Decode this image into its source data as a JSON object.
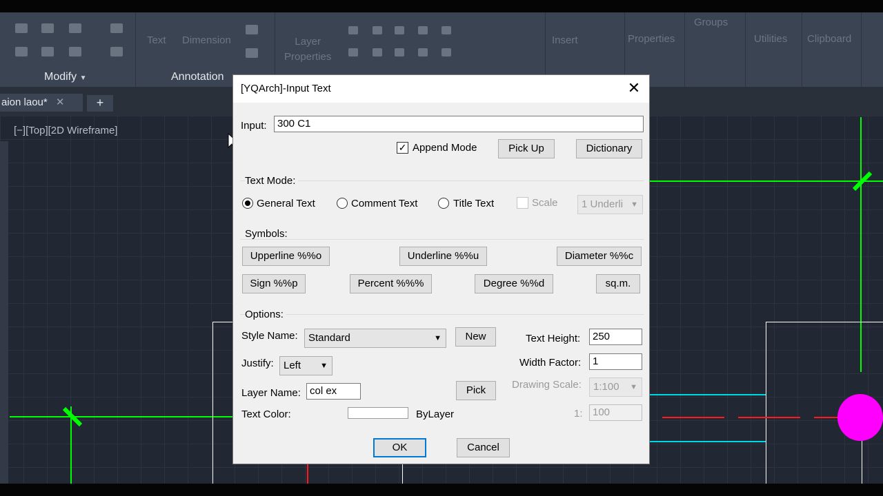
{
  "ribbon": {
    "text_label": "Text",
    "dimension_label": "Dimension",
    "layer_properties_label": "Layer\nProperties",
    "insert_label": "Insert",
    "properties_label": "Properties",
    "groups_label": "Groups",
    "utilities_label": "Utilities",
    "clipboard_label": "Clipboard",
    "modify_panel": "Modify",
    "annotation_panel": "Annotation"
  },
  "tabs": {
    "file_tab": "aion laou*",
    "close_glyph": "✕",
    "new_tab_glyph": "+"
  },
  "viewport": {
    "label": "[−][Top][2D Wireframe]"
  },
  "dialog": {
    "title": "[YQArch]-Input Text",
    "input_label": "Input:",
    "input_value": "300 C1",
    "append_mode_label": "Append Mode",
    "append_mode_checked": true,
    "pick_up_label": "Pick Up",
    "dictionary_label": "Dictionary",
    "text_mode_label": "Text Mode:",
    "mode_general": "General Text",
    "mode_comment": "Comment Text",
    "mode_title": "Title Text",
    "selected_mode": "General Text",
    "scale_label": "Scale",
    "underline_combo": "1 Underli",
    "symbols_label": "Symbols:",
    "sym_upperline": "Upperline %%o",
    "sym_underline": "Underline %%u",
    "sym_diameter": "Diameter %%c",
    "sym_sign": "Sign %%p",
    "sym_percent": "Percent %%%",
    "sym_degree": "Degree %%d",
    "sym_sqm": "sq.m.",
    "options_label": "Options:",
    "style_name_label": "Style Name:",
    "style_name_value": "Standard",
    "new_label": "New",
    "text_height_label": "Text Height:",
    "text_height_value": "250",
    "justify_label": "Justify:",
    "justify_value": "Left",
    "width_factor_label": "Width Factor:",
    "width_factor_value": "1",
    "drawing_scale_label": "Drawing Scale:",
    "drawing_scale_value": "1:100",
    "layer_name_label": "Layer Name:",
    "layer_name_value": "col ex",
    "pick_label": "Pick",
    "scale_prefix": "1:",
    "scale_value": "100",
    "text_color_label": "Text Color:",
    "text_color_value": "ByLayer",
    "ok_label": "OK",
    "cancel_label": "Cancel"
  },
  "colors": {
    "green": "#00ff00",
    "cyan": "#00d8e8",
    "red": "#ff1a1a",
    "magenta": "#ff00ff",
    "white": "#ffffff"
  }
}
